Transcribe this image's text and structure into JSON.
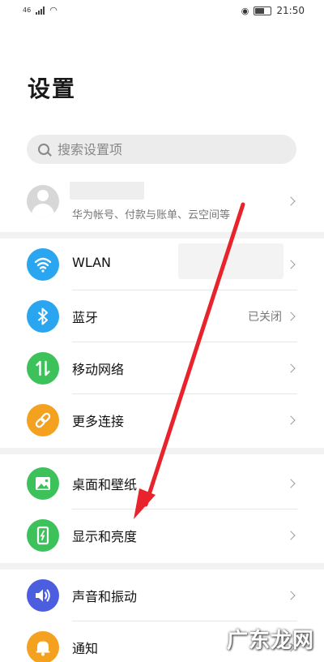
{
  "status": {
    "time": "21:50",
    "left": "46"
  },
  "header": {
    "title": "设置"
  },
  "search": {
    "placeholder": "搜索设置项"
  },
  "account": {
    "subtitle": "华为帐号、付款与账单、云空间等"
  },
  "group1": [
    {
      "label": "WLAN",
      "value": "",
      "icon": "wifi-icon",
      "color": "#2aa6f0"
    },
    {
      "label": "蓝牙",
      "value": "已关闭",
      "icon": "bluetooth-icon",
      "color": "#2aa6f0"
    },
    {
      "label": "移动网络",
      "value": "",
      "icon": "mobile-data-icon",
      "color": "#3cc15b"
    },
    {
      "label": "更多连接",
      "value": "",
      "icon": "link-icon",
      "color": "#f5a120"
    }
  ],
  "group2": [
    {
      "label": "桌面和壁纸",
      "value": "",
      "icon": "wallpaper-icon",
      "color": "#3cc15b"
    },
    {
      "label": "显示和亮度",
      "value": "",
      "icon": "brightness-icon",
      "color": "#3cc15b"
    }
  ],
  "group3": [
    {
      "label": "声音和振动",
      "value": "",
      "icon": "volume-icon",
      "color": "#4b5ee0"
    },
    {
      "label": "通知",
      "value": "",
      "icon": "bell-icon",
      "color": "#f5a120"
    }
  ],
  "watermark": {
    "text": "广东龙网"
  }
}
